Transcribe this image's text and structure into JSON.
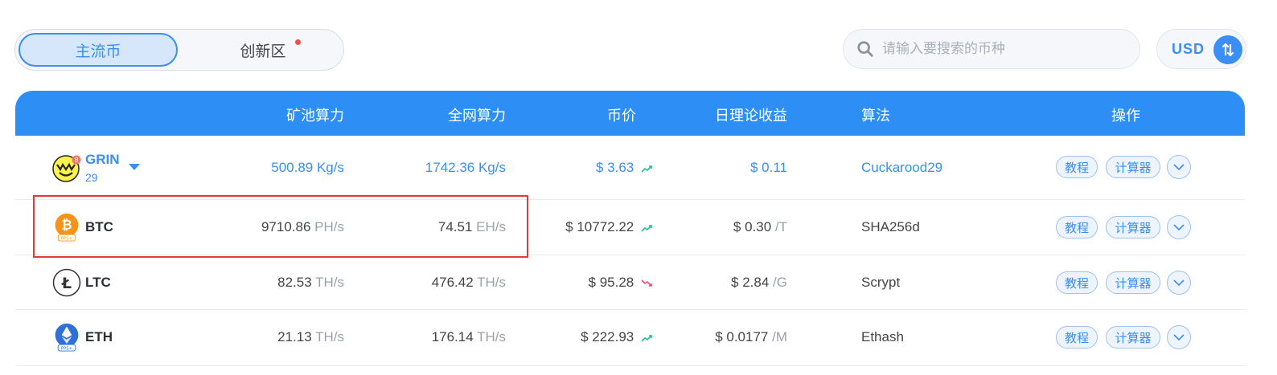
{
  "tabs": {
    "main": "主流币",
    "innovation": "创新区"
  },
  "search": {
    "placeholder": "请输入要搜索的币种"
  },
  "currency": {
    "label": "USD"
  },
  "columns": {
    "pool_hashrate": "矿池算力",
    "network_hashrate": "全网算力",
    "price": "币价",
    "daily_income": "日理论收益",
    "algorithm": "算法",
    "actions": "操作"
  },
  "rows": [
    {
      "coin": "GRIN",
      "sub": "29",
      "badge": "8",
      "pool_value": "500.89 Kg/s",
      "network_value": "1742.36 Kg/s",
      "price": "$ 3.63",
      "income": "$ 0.11",
      "algorithm": "Cuckarood29",
      "trend": "up"
    },
    {
      "coin": "BTC",
      "badge": "PPS+",
      "pool_value": "9710.86",
      "pool_unit": "PH/s",
      "network_value": "74.51",
      "network_unit": "EH/s",
      "price": "$ 10772.22",
      "income": "$ 0.30",
      "income_unit": "/T",
      "algorithm": "SHA256d",
      "trend": "up"
    },
    {
      "coin": "LTC",
      "pool_value": "82.53",
      "pool_unit": "TH/s",
      "network_value": "476.42",
      "network_unit": "TH/s",
      "price": "$ 95.28",
      "income": "$ 2.84",
      "income_unit": "/G",
      "algorithm": "Scrypt",
      "trend": "down"
    },
    {
      "coin": "ETH",
      "badge": "PPS+",
      "pool_value": "21.13",
      "pool_unit": "TH/s",
      "network_value": "176.14",
      "network_unit": "TH/s",
      "price": "$ 222.93",
      "income": "$ 0.0177",
      "income_unit": "/M",
      "algorithm": "Ethash",
      "trend": "up"
    }
  ],
  "buttons": {
    "tutorial": "教程",
    "calculator": "计算器"
  },
  "colors": {
    "accent": "#2d8ff6",
    "up": "#1fc28a",
    "down": "#f0506e",
    "highlight": "#e03b3b",
    "btc": "#f7931a",
    "eth": "#2e6fd8"
  }
}
